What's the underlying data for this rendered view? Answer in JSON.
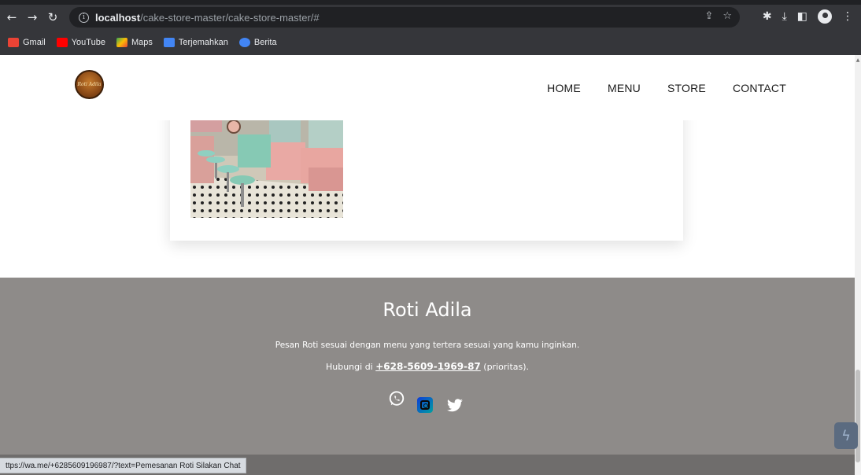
{
  "browser": {
    "url_host": "localhost",
    "url_path": "/cake-store-master/cake-store-master/#",
    "bookmarks": [
      {
        "label": "Gmail",
        "color": "#ea4335"
      },
      {
        "label": "YouTube",
        "color": "#ff0000"
      },
      {
        "label": "Maps",
        "color": "#34a853"
      },
      {
        "label": "Terjemahkan",
        "color": "#4285f4"
      },
      {
        "label": "Berita",
        "color": "#4285f4"
      }
    ],
    "status_url": "ttps://wa.me/+6285609196987/?text=Pemesanan Roti Silakan Chat"
  },
  "navbar": {
    "logo_text": "Roti Adila",
    "links": [
      "HOME",
      "MENU",
      "STORE",
      "CONTACT"
    ]
  },
  "footer": {
    "title": "Roti Adila",
    "description": "Pesan Roti sesuai dengan menu yang tertera sesuai yang kamu inginkan.",
    "contact_prefix": "Hubungi di ",
    "phone": "+628-5609-1969-87",
    "contact_suffix": " (prioritas).",
    "background_color": "#8e8b89"
  }
}
